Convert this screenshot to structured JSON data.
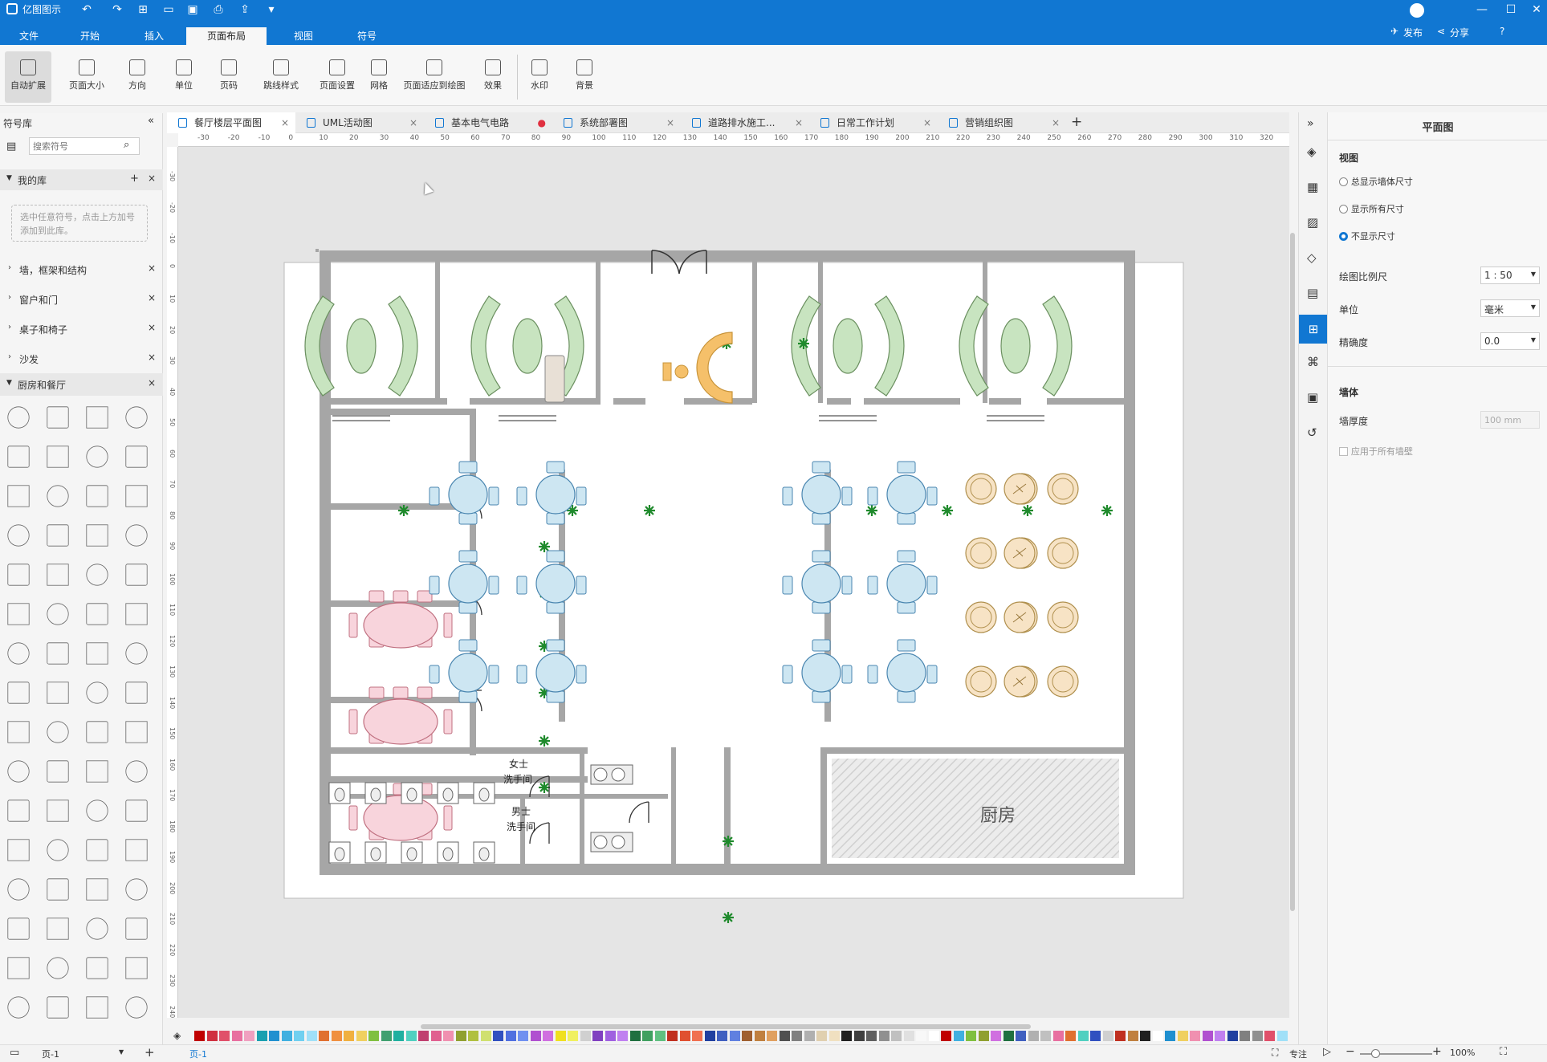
{
  "app": {
    "name": "亿图图示",
    "publish": "发布",
    "share": "分享"
  },
  "menu": [
    "文件",
    "开始",
    "插入",
    "页面布局",
    "视图",
    "符号"
  ],
  "menu_active": 3,
  "ribbon": [
    "自动扩展",
    "页面大小",
    "方向",
    "单位",
    "页码",
    "跳线样式",
    "页面设置",
    "网格",
    "页面适应到绘图",
    "效果",
    "水印",
    "背景"
  ],
  "symlib": {
    "title": "符号库",
    "search_placeholder": "搜索符号",
    "mylib": "我的库",
    "mylib_hint": "选中任意符号，点击上方加号添加到此库。",
    "categories": [
      "墙，框架和结构",
      "窗户和门",
      "桌子和椅子",
      "沙发"
    ],
    "open_category": "厨房和餐厅"
  },
  "tabs": [
    "餐厅楼层平面图",
    "UML活动图",
    "基本电气电路",
    "系统部署图",
    "道路排水施工...",
    "日常工作计划",
    "营销组织图"
  ],
  "tab_active": 0,
  "plan": {
    "kitchen": "厨房",
    "ladies_1": "女士",
    "ladies_2": "洗手间",
    "men_1": "男士",
    "men_2": "洗手间"
  },
  "ruler": {
    "h": [
      "-30",
      "-20",
      "-10",
      "0",
      "10",
      "20",
      "30",
      "40",
      "50",
      "60",
      "70",
      "80",
      "90",
      "100",
      "110",
      "120",
      "130",
      "140",
      "150",
      "160",
      "170",
      "180",
      "190",
      "200",
      "210",
      "220",
      "230",
      "240",
      "250",
      "260",
      "270",
      "280",
      "290",
      "300",
      "310",
      "320"
    ],
    "v": [
      "-30",
      "-20",
      "-10",
      "0",
      "10",
      "20",
      "30",
      "40",
      "50",
      "60",
      "70",
      "80",
      "90",
      "100",
      "110",
      "120",
      "130",
      "140",
      "150",
      "160",
      "170",
      "180",
      "190",
      "200",
      "210",
      "220",
      "230",
      "240"
    ]
  },
  "panel": {
    "title": "平面图",
    "view_section": "视图",
    "view_options": [
      "总显示墙体尺寸",
      "显示所有尺寸",
      "不显示尺寸"
    ],
    "view_selected": 2,
    "scale_label": "绘图比例尺",
    "scale_value": "1 : 50",
    "unit_label": "单位",
    "unit_value": "毫米",
    "precision_label": "精确度",
    "precision_value": "0.0",
    "wall_section": "墙体",
    "wall_thickness_label": "墙厚度",
    "wall_thickness_value": "100 mm",
    "apply_all": "应用于所有墙壁"
  },
  "status": {
    "page": "页-1",
    "page_tab": "页-1",
    "focus": "专注",
    "zoom": "100%"
  },
  "colors": {
    "accent": "#1177d2",
    "sofa": "#c8e4c0",
    "pink": "#f8d4dc",
    "blue": "#cde6f2",
    "cream": "#f7e3c5",
    "wall": "#a6a6a6"
  }
}
